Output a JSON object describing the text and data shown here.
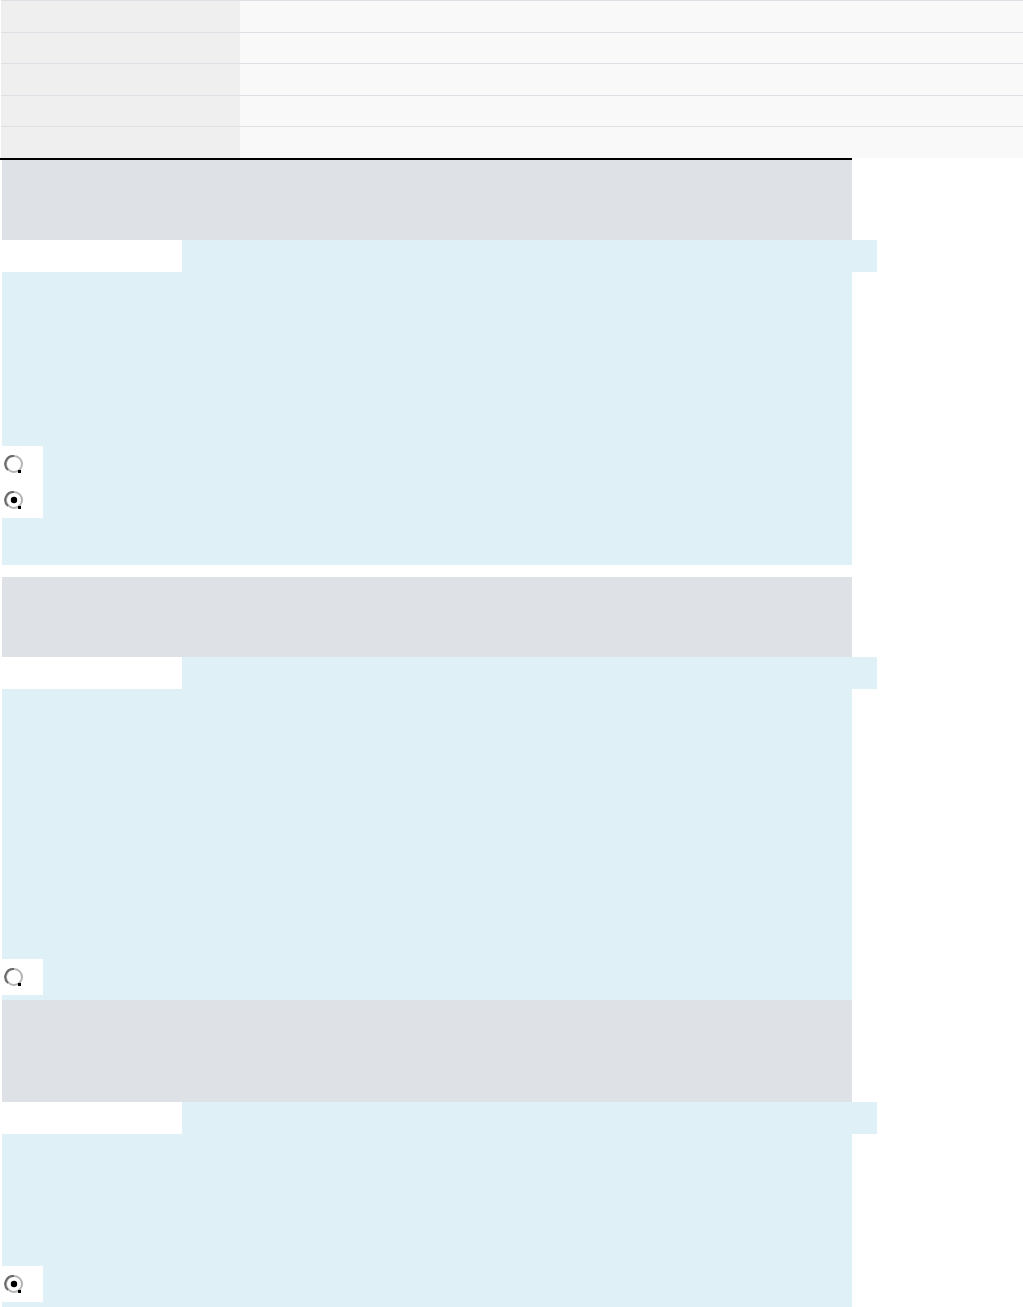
{
  "questions": [
    {
      "options": [
        {
          "selected": false
        },
        {
          "selected": true
        }
      ]
    },
    {
      "options": [
        {
          "selected": false
        }
      ]
    },
    {
      "options": [
        {
          "selected": true
        }
      ]
    }
  ]
}
